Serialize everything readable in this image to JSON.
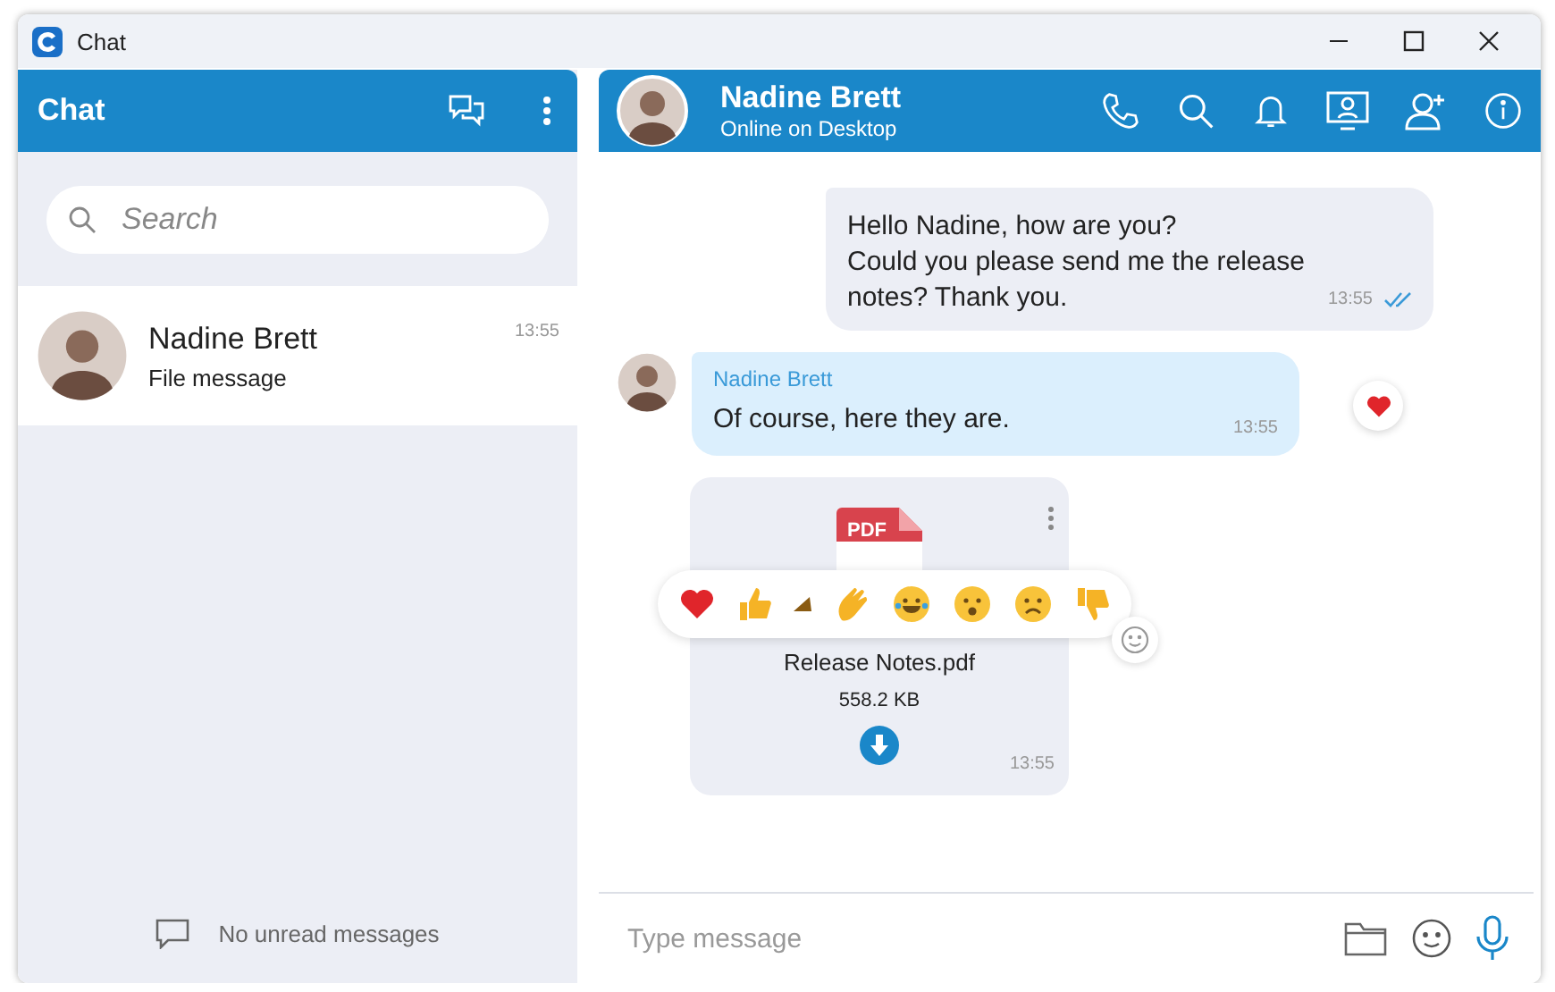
{
  "window": {
    "title": "Chat"
  },
  "sidebar": {
    "title": "Chat",
    "search": {
      "placeholder": "Search"
    },
    "conversations": [
      {
        "name": "Nadine Brett",
        "preview": "File message",
        "time": "13:55",
        "selected": true
      }
    ],
    "footer": "No unread messages"
  },
  "conversation": {
    "name": "Nadine Brett",
    "status": "Online on Desktop"
  },
  "messages": [
    {
      "kind": "outgoing",
      "text": "Hello Nadine, how are you?\nCould you please send me the release\nnotes? Thank you.",
      "time": "13:55",
      "read": true
    },
    {
      "kind": "incoming",
      "sender": "Nadine Brett",
      "text": "Of course, here they are.",
      "time": "13:55",
      "reacted": true
    },
    {
      "kind": "file",
      "file_type": "PDF",
      "file_name": "Release Notes.pdf",
      "size": "558.2 KB",
      "time": "13:55",
      "reaction_picker_open": true
    }
  ],
  "composer": {
    "placeholder": "Type message"
  }
}
